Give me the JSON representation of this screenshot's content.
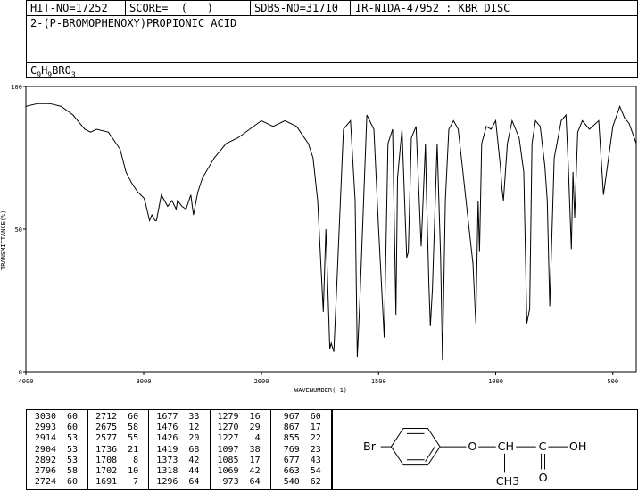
{
  "header": {
    "hit_no": "HIT-NO=17252",
    "score": "SCORE=  (   )",
    "sdbs_no": "SDBS-NO=31710",
    "ir_no": "IR-NIDA-47952 : KBR DISC"
  },
  "compound_name": "2-(P-BROMOPHENOXY)PROPIONIC ACID",
  "formula": {
    "c": "C",
    "c_n": "9",
    "h": "H",
    "h_n": "9",
    "rest": "BRO",
    "o_n": "3"
  },
  "chart_data": {
    "type": "line",
    "xlabel": "WAVENUMBER(-1)",
    "ylabel": "TRANSMITTANCE(%)",
    "x_ticks": [
      "4000",
      "3000",
      "2000",
      "1500",
      "1000",
      "500"
    ],
    "y_ticks": [
      "100",
      "50",
      "0"
    ],
    "xlim": [
      4000,
      400
    ],
    "ylim": [
      0,
      100
    ],
    "series": [
      {
        "x": [
          4000,
          3900,
          3800,
          3700,
          3600,
          3500,
          3450,
          3400,
          3300,
          3200,
          3150,
          3100,
          3050,
          3000,
          2990,
          2950,
          2930,
          2904,
          2892,
          2850,
          2796,
          2760,
          2724,
          2712,
          2675,
          2640,
          2600,
          2577,
          2540,
          2500,
          2400,
          2300,
          2200,
          2100,
          2000,
          1950,
          1900,
          1850,
          1800,
          1780,
          1760,
          1736,
          1725,
          1708,
          1702,
          1691,
          1677,
          1650,
          1620,
          1600,
          1591,
          1580,
          1550,
          1520,
          1500,
          1476,
          1460,
          1440,
          1426,
          1419,
          1400,
          1380,
          1373,
          1360,
          1340,
          1318,
          1300,
          1296,
          1285,
          1279,
          1270,
          1250,
          1235,
          1227,
          1215,
          1200,
          1180,
          1160,
          1140,
          1120,
          1097,
          1085,
          1075,
          1069,
          1060,
          1040,
          1020,
          1000,
          980,
          973,
          967,
          950,
          930,
          900,
          880,
          867,
          855,
          845,
          830,
          810,
          790,
          780,
          769,
          750,
          720,
          700,
          690,
          677,
          670,
          663,
          650,
          630,
          600,
          560,
          540,
          500,
          470,
          450,
          430,
          400
        ],
        "y": [
          93,
          94,
          94,
          93,
          90,
          85,
          84,
          85,
          84,
          78,
          70,
          66,
          63,
          61,
          60,
          53,
          55,
          53,
          53,
          62,
          58,
          60,
          57,
          60,
          58,
          57,
          62,
          55,
          63,
          68,
          75,
          80,
          82,
          85,
          88,
          86,
          88,
          86,
          80,
          75,
          60,
          21,
          50,
          8,
          10,
          7,
          33,
          85,
          88,
          60,
          5,
          25,
          90,
          85,
          50,
          12,
          80,
          85,
          20,
          68,
          85,
          40,
          42,
          82,
          86,
          44,
          80,
          64,
          30,
          16,
          29,
          80,
          40,
          4,
          60,
          85,
          88,
          85,
          70,
          55,
          38,
          17,
          60,
          42,
          80,
          86,
          85,
          88,
          72,
          64,
          60,
          80,
          88,
          82,
          70,
          17,
          22,
          80,
          88,
          86,
          72,
          60,
          23,
          75,
          88,
          90,
          72,
          43,
          70,
          54,
          84,
          88,
          85,
          88,
          62,
          86,
          93,
          89,
          87,
          80
        ]
      }
    ],
    "grid": false
  },
  "peaks": [
    [
      [
        "3030",
        "60"
      ],
      [
        "2993",
        "60"
      ],
      [
        "2914",
        "53"
      ],
      [
        "2904",
        "53"
      ],
      [
        "2892",
        "53"
      ],
      [
        "2796",
        "58"
      ],
      [
        "2724",
        "60"
      ]
    ],
    [
      [
        "2712",
        "60"
      ],
      [
        "2675",
        "58"
      ],
      [
        "2577",
        "55"
      ],
      [
        "1736",
        "21"
      ],
      [
        "1708",
        "8"
      ],
      [
        "1702",
        "10"
      ],
      [
        "1691",
        "7"
      ]
    ],
    [
      [
        "1677",
        "33"
      ],
      [
        "1476",
        "12"
      ],
      [
        "1426",
        "20"
      ],
      [
        "1419",
        "68"
      ],
      [
        "1373",
        "42"
      ],
      [
        "1318",
        "44"
      ],
      [
        "1296",
        "64"
      ]
    ],
    [
      [
        "1279",
        "16"
      ],
      [
        "1270",
        "29"
      ],
      [
        "1227",
        "4"
      ],
      [
        "1097",
        "38"
      ],
      [
        "1085",
        "17"
      ],
      [
        "1069",
        "42"
      ],
      [
        "973",
        "64"
      ]
    ],
    [
      [
        "967",
        "60"
      ],
      [
        "867",
        "17"
      ],
      [
        "855",
        "22"
      ],
      [
        "769",
        "23"
      ],
      [
        "677",
        "43"
      ],
      [
        "663",
        "54"
      ],
      [
        "540",
        "62"
      ]
    ]
  ],
  "structure": {
    "br": "Br",
    "o1": "O",
    "ch": "CH",
    "c": "C",
    "oh": "OH",
    "o2": "O",
    "ch3": "CH3"
  }
}
